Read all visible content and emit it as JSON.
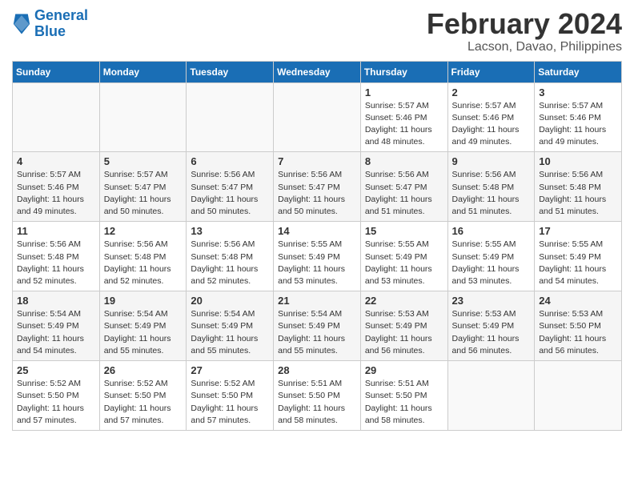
{
  "header": {
    "logo_line1": "General",
    "logo_line2": "Blue",
    "month_title": "February 2024",
    "location": "Lacson, Davao, Philippines"
  },
  "days_of_week": [
    "Sunday",
    "Monday",
    "Tuesday",
    "Wednesday",
    "Thursday",
    "Friday",
    "Saturday"
  ],
  "weeks": [
    [
      {
        "day": "",
        "info": ""
      },
      {
        "day": "",
        "info": ""
      },
      {
        "day": "",
        "info": ""
      },
      {
        "day": "",
        "info": ""
      },
      {
        "day": "1",
        "info": "Sunrise: 5:57 AM\nSunset: 5:46 PM\nDaylight: 11 hours and 48 minutes."
      },
      {
        "day": "2",
        "info": "Sunrise: 5:57 AM\nSunset: 5:46 PM\nDaylight: 11 hours and 49 minutes."
      },
      {
        "day": "3",
        "info": "Sunrise: 5:57 AM\nSunset: 5:46 PM\nDaylight: 11 hours and 49 minutes."
      }
    ],
    [
      {
        "day": "4",
        "info": "Sunrise: 5:57 AM\nSunset: 5:46 PM\nDaylight: 11 hours and 49 minutes."
      },
      {
        "day": "5",
        "info": "Sunrise: 5:57 AM\nSunset: 5:47 PM\nDaylight: 11 hours and 50 minutes."
      },
      {
        "day": "6",
        "info": "Sunrise: 5:56 AM\nSunset: 5:47 PM\nDaylight: 11 hours and 50 minutes."
      },
      {
        "day": "7",
        "info": "Sunrise: 5:56 AM\nSunset: 5:47 PM\nDaylight: 11 hours and 50 minutes."
      },
      {
        "day": "8",
        "info": "Sunrise: 5:56 AM\nSunset: 5:47 PM\nDaylight: 11 hours and 51 minutes."
      },
      {
        "day": "9",
        "info": "Sunrise: 5:56 AM\nSunset: 5:48 PM\nDaylight: 11 hours and 51 minutes."
      },
      {
        "day": "10",
        "info": "Sunrise: 5:56 AM\nSunset: 5:48 PM\nDaylight: 11 hours and 51 minutes."
      }
    ],
    [
      {
        "day": "11",
        "info": "Sunrise: 5:56 AM\nSunset: 5:48 PM\nDaylight: 11 hours and 52 minutes."
      },
      {
        "day": "12",
        "info": "Sunrise: 5:56 AM\nSunset: 5:48 PM\nDaylight: 11 hours and 52 minutes."
      },
      {
        "day": "13",
        "info": "Sunrise: 5:56 AM\nSunset: 5:48 PM\nDaylight: 11 hours and 52 minutes."
      },
      {
        "day": "14",
        "info": "Sunrise: 5:55 AM\nSunset: 5:49 PM\nDaylight: 11 hours and 53 minutes."
      },
      {
        "day": "15",
        "info": "Sunrise: 5:55 AM\nSunset: 5:49 PM\nDaylight: 11 hours and 53 minutes."
      },
      {
        "day": "16",
        "info": "Sunrise: 5:55 AM\nSunset: 5:49 PM\nDaylight: 11 hours and 53 minutes."
      },
      {
        "day": "17",
        "info": "Sunrise: 5:55 AM\nSunset: 5:49 PM\nDaylight: 11 hours and 54 minutes."
      }
    ],
    [
      {
        "day": "18",
        "info": "Sunrise: 5:54 AM\nSunset: 5:49 PM\nDaylight: 11 hours and 54 minutes."
      },
      {
        "day": "19",
        "info": "Sunrise: 5:54 AM\nSunset: 5:49 PM\nDaylight: 11 hours and 55 minutes."
      },
      {
        "day": "20",
        "info": "Sunrise: 5:54 AM\nSunset: 5:49 PM\nDaylight: 11 hours and 55 minutes."
      },
      {
        "day": "21",
        "info": "Sunrise: 5:54 AM\nSunset: 5:49 PM\nDaylight: 11 hours and 55 minutes."
      },
      {
        "day": "22",
        "info": "Sunrise: 5:53 AM\nSunset: 5:49 PM\nDaylight: 11 hours and 56 minutes."
      },
      {
        "day": "23",
        "info": "Sunrise: 5:53 AM\nSunset: 5:49 PM\nDaylight: 11 hours and 56 minutes."
      },
      {
        "day": "24",
        "info": "Sunrise: 5:53 AM\nSunset: 5:50 PM\nDaylight: 11 hours and 56 minutes."
      }
    ],
    [
      {
        "day": "25",
        "info": "Sunrise: 5:52 AM\nSunset: 5:50 PM\nDaylight: 11 hours and 57 minutes."
      },
      {
        "day": "26",
        "info": "Sunrise: 5:52 AM\nSunset: 5:50 PM\nDaylight: 11 hours and 57 minutes."
      },
      {
        "day": "27",
        "info": "Sunrise: 5:52 AM\nSunset: 5:50 PM\nDaylight: 11 hours and 57 minutes."
      },
      {
        "day": "28",
        "info": "Sunrise: 5:51 AM\nSunset: 5:50 PM\nDaylight: 11 hours and 58 minutes."
      },
      {
        "day": "29",
        "info": "Sunrise: 5:51 AM\nSunset: 5:50 PM\nDaylight: 11 hours and 58 minutes."
      },
      {
        "day": "",
        "info": ""
      },
      {
        "day": "",
        "info": ""
      }
    ]
  ]
}
